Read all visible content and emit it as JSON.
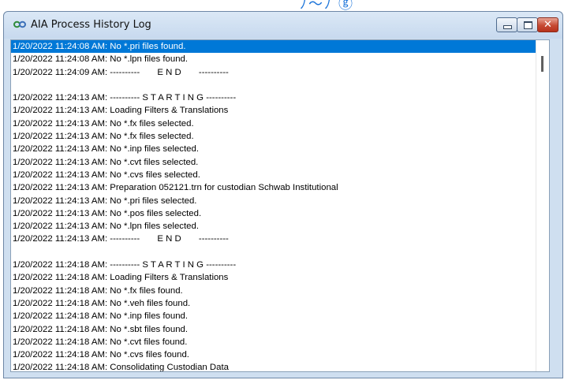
{
  "window": {
    "title": "AIA Process History Log",
    "controls": {
      "minimize": "minimize",
      "maximize": "maximize",
      "close": "✕"
    }
  },
  "log": {
    "selected_index": 0,
    "lines": [
      "1/20/2022 11:24:08 AM: No *.pri files found.",
      "1/20/2022 11:24:08 AM: No *.lpn files found.",
      "1/20/2022 11:24:09 AM: ----------       E N D       ----------",
      "",
      "1/20/2022 11:24:13 AM: ---------- S T A R T I N G ----------",
      "1/20/2022 11:24:13 AM: Loading Filters & Translations",
      "1/20/2022 11:24:13 AM: No *.fx files selected.",
      "1/20/2022 11:24:13 AM: No *.fx files selected.",
      "1/20/2022 11:24:13 AM: No *.inp files selected.",
      "1/20/2022 11:24:13 AM: No *.cvt files selected.",
      "1/20/2022 11:24:13 AM: No *.cvs files selected.",
      "1/20/2022 11:24:13 AM: Preparation 052121.trn for custodian Schwab Institutional",
      "1/20/2022 11:24:13 AM: No *.pri files selected.",
      "1/20/2022 11:24:13 AM: No *.pos files selected.",
      "1/20/2022 11:24:13 AM: No *.lpn files selected.",
      "1/20/2022 11:24:13 AM: ----------       E N D       ----------",
      "",
      "1/20/2022 11:24:18 AM: ---------- S T A R T I N G ----------",
      "1/20/2022 11:24:18 AM: Loading Filters & Translations",
      "1/20/2022 11:24:18 AM: No *.fx files found.",
      "1/20/2022 11:24:18 AM: No *.veh files found.",
      "1/20/2022 11:24:18 AM: No *.inp files found.",
      "1/20/2022 11:24:18 AM: No *.sbt files found.",
      "1/20/2022 11:24:18 AM: No *.cvt files found.",
      "1/20/2022 11:24:18 AM: No *.cvs files found.",
      "1/20/2022 11:24:18 AM: Consolidating Custodian Data"
    ]
  },
  "colors": {
    "selection": "#0078d7",
    "titlebar": "#cfdff0",
    "close_button": "#c64a33"
  },
  "icons": {
    "app": "infinity-loop-icon",
    "minimize": "minimize-icon",
    "maximize": "maximize-icon",
    "close": "close-icon"
  }
}
